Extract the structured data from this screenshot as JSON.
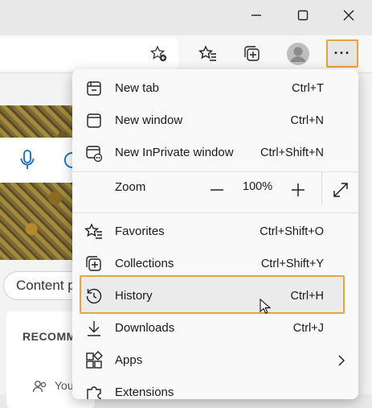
{
  "window": {
    "minimize_icon": "minimize-icon",
    "maximize_icon": "maximize-icon",
    "close_icon": "close-icon"
  },
  "toolbar": {
    "more_label": "···"
  },
  "page": {
    "search_pill": "Content p",
    "recommended": "RECOMM",
    "you_text": "You"
  },
  "menu": {
    "items": [
      {
        "label": "New tab",
        "shortcut": "Ctrl+T"
      },
      {
        "label": "New window",
        "shortcut": "Ctrl+N"
      },
      {
        "label": "New InPrivate window",
        "shortcut": "Ctrl+Shift+N"
      }
    ],
    "zoom": {
      "label": "Zoom",
      "value": "100%"
    },
    "items2": [
      {
        "label": "Favorites",
        "shortcut": "Ctrl+Shift+O"
      },
      {
        "label": "Collections",
        "shortcut": "Ctrl+Shift+Y"
      },
      {
        "label": "History",
        "shortcut": "Ctrl+H"
      },
      {
        "label": "Downloads",
        "shortcut": "Ctrl+J"
      },
      {
        "label": "Apps",
        "shortcut": ""
      },
      {
        "label": "Extensions",
        "shortcut": ""
      }
    ]
  },
  "colors": {
    "highlight": "#e8a33d",
    "accent": "#0f6cbd"
  }
}
